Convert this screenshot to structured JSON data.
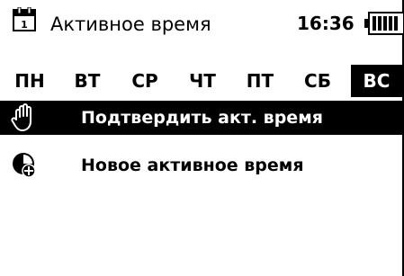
{
  "header": {
    "calendar_day": "1",
    "title": "Активное время",
    "time": "16:36",
    "battery_level": 1.0
  },
  "weekdays": {
    "selected": "ВС",
    "items": [
      "ПН",
      "ВТ",
      "СР",
      "ЧТ",
      "ПТ",
      "СБ",
      "ВС"
    ]
  },
  "menu": {
    "items": [
      {
        "label": "Подтвердить акт. время",
        "icon": "hand-icon",
        "selected": true
      },
      {
        "label": "Новое активное время",
        "icon": "clock-add-icon",
        "selected": false
      }
    ]
  }
}
